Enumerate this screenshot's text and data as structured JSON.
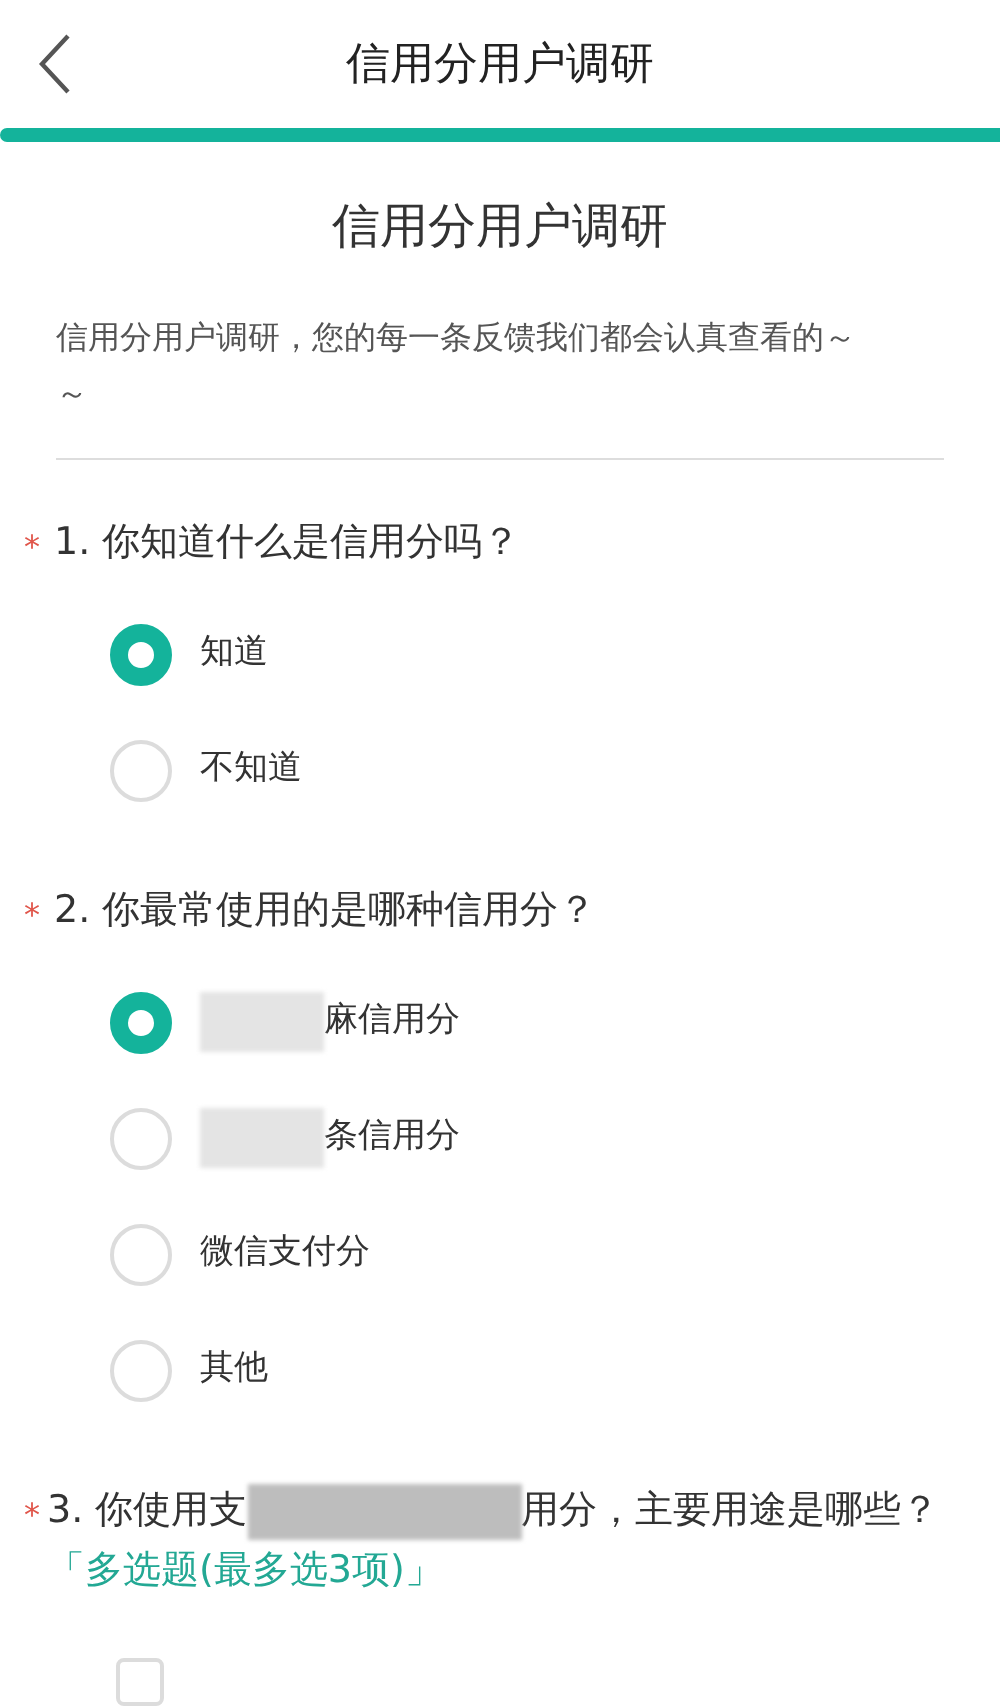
{
  "header": {
    "title": "信用分用户调研"
  },
  "survey": {
    "title": "信用分用户调研",
    "description": "信用分用户调研，您的每一条反馈我们都会认真查看的～～"
  },
  "questions": [
    {
      "kind": "radio",
      "required_mark": "*",
      "title_parts": [
        "1. 你知道什么是信用分吗？"
      ],
      "options": [
        {
          "label": "知道",
          "selected": true,
          "blurred": false
        },
        {
          "label": "不知道",
          "selected": false,
          "blurred": false
        }
      ]
    },
    {
      "kind": "radio",
      "required_mark": "*",
      "title_parts": [
        "2. 你最常使用的是哪种信用分？"
      ],
      "options": [
        {
          "label": "麻信用分",
          "selected": true,
          "blurred": true
        },
        {
          "label": "条信用分",
          "selected": false,
          "blurred": true
        },
        {
          "label": "微信支付分",
          "selected": false,
          "blurred": false
        },
        {
          "label": "其他",
          "selected": false,
          "blurred": false
        }
      ]
    },
    {
      "kind": "checkbox",
      "required_mark": "*",
      "title_parts": [
        "3. 你使用支",
        "用分，主要用途是哪些？"
      ],
      "hint": "「多选题(最多选3项)」",
      "options": [
        {
          "checked": false
        }
      ]
    }
  ]
}
